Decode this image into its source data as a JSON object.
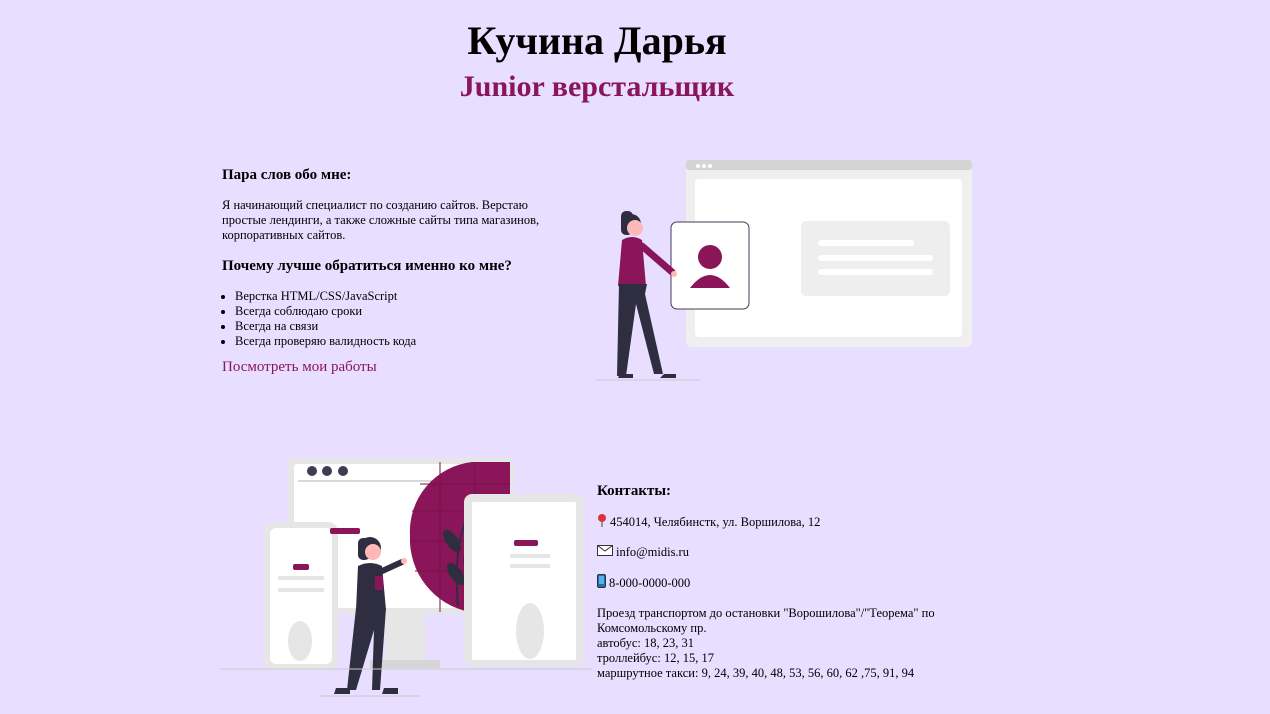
{
  "header": {
    "name": "Кучина Дарья",
    "role": "Junior верстальщик"
  },
  "about": {
    "heading": "Пара слов обо мне:",
    "text": "Я начинающий специалист по созданию сайтов. Верстаю простые лендинги, а также сложные сайты типа магазинов, корпоративных сайтов.",
    "why_heading": "Почему лучше обратиться именно ко мне?",
    "items": [
      "Верстка HTML/CSS/JavaScript",
      "Всегда соблюдаю сроки",
      "Всегда на связи",
      "Всегда проверяю валидность кода"
    ],
    "works_link": "Посмотреть мои работы"
  },
  "contacts": {
    "heading": "Контакты:",
    "address": "454014, Челябинстк, ул. Воршилова, 12",
    "email": "info@midis.ru",
    "phone": "8-000-0000-000",
    "transport": [
      "Проезд транспортом до остановки \"Ворошилова\"/\"Теорема\" по Комсомольскому пр.",
      "автобус: 18, 23, 31",
      "троллейбус: 12, 15, 17",
      "маршрутное такси: 9, 24, 39, 40, 48, 53, 56, 60, 62 ,75, 91, 94"
    ],
    "icons": [
      "map-pin-icon",
      "envelope-icon",
      "mobile-phone-icon"
    ]
  },
  "colors": {
    "background": "#e8deff",
    "accent": "#8a1659"
  }
}
